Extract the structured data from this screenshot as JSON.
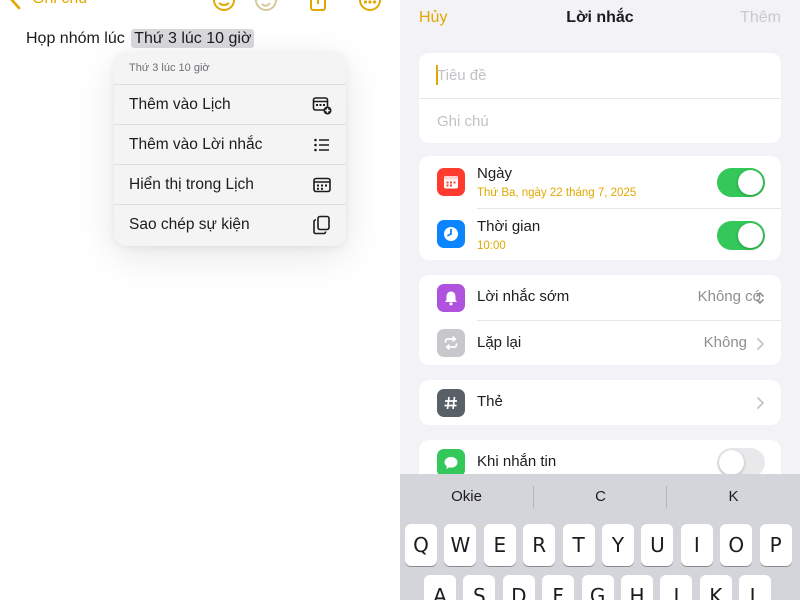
{
  "notes": {
    "back_label": "Ghi chú",
    "note_prefix": "Họp nhóm lúc",
    "note_highlight": "Thứ 3 lúc 10 giờ",
    "menu": {
      "header": "Thứ 3 lúc 10 giờ",
      "items": [
        {
          "label": "Thêm vào Lịch",
          "icon": "calendar-add-icon"
        },
        {
          "label": "Thêm vào Lời nhắc",
          "icon": "list-icon"
        },
        {
          "label": "Hiển thị trong Lịch",
          "icon": "calendar-icon"
        },
        {
          "label": "Sao chép sự kiện",
          "icon": "copy-icon"
        }
      ]
    }
  },
  "reminder": {
    "cancel": "Hủy",
    "title": "Lời nhắc",
    "add": "Thêm",
    "title_placeholder": "Tiêu đề",
    "notes_placeholder": "Ghi chú",
    "date": {
      "label": "Ngày",
      "value": "Thứ Ba, ngày 22 tháng 7, 2025",
      "enabled": true,
      "icon_color": "#ff3b30"
    },
    "time": {
      "label": "Thời gian",
      "value": "10:00",
      "enabled": true,
      "icon_color": "#0a84ff"
    },
    "early_reminder": {
      "label": "Lời nhắc sớm",
      "value": "Không có",
      "icon_color": "#af52de"
    },
    "repeat": {
      "label": "Lặp lại",
      "value": "Không",
      "icon_color": "#c7c7cc"
    },
    "tags": {
      "label": "Thẻ",
      "icon_color": "#5a6068"
    },
    "messaging": {
      "label": "Khi nhắn tin",
      "enabled": false,
      "icon_color": "#34c759"
    }
  },
  "keyboard": {
    "suggestions": [
      "Okie",
      "C",
      "K"
    ],
    "row1": [
      "Q",
      "W",
      "E",
      "R",
      "T",
      "Y",
      "U",
      "I",
      "O",
      "P"
    ],
    "row2": [
      "A",
      "S",
      "D",
      "F",
      "G",
      "H",
      "J",
      "K",
      "L"
    ]
  },
  "colors": {
    "accent": "#e0a800",
    "toggle_on": "#34c759"
  }
}
